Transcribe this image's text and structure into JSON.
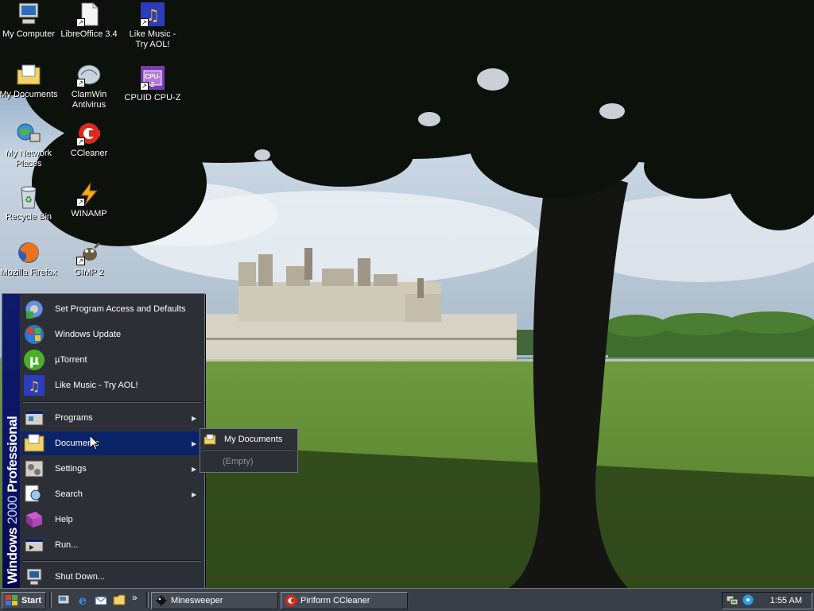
{
  "desktop": {
    "icons": [
      {
        "label": "My Computer",
        "icon": "my-computer-icon"
      },
      {
        "label": "LibreOffice 3.4",
        "icon": "libreoffice-icon"
      },
      {
        "label": "Like Music - Try AOL!",
        "icon": "like-music-icon"
      },
      {
        "label": "My Documents",
        "icon": "my-documents-icon"
      },
      {
        "label": "ClamWin Antivirus",
        "icon": "clamwin-icon"
      },
      {
        "label": "CPUID CPU-Z",
        "icon": "cpuz-icon",
        "badge": "CPU-Z"
      },
      {
        "label": "My Network Places",
        "icon": "network-places-icon"
      },
      {
        "label": "CCleaner",
        "icon": "ccleaner-icon"
      },
      {
        "label": "Recycle Bin",
        "icon": "recycle-bin-icon"
      },
      {
        "label": "WINAMP",
        "icon": "winamp-icon"
      },
      {
        "label": "Mozilla Firefox",
        "icon": "firefox-icon"
      },
      {
        "label": "GIMP 2",
        "icon": "gimp-icon"
      }
    ]
  },
  "start_menu": {
    "banner_bold": "Windows",
    "banner_thin": "2000",
    "banner_rest": "Professional",
    "pinned": [
      {
        "label": "Set Program Access and Defaults",
        "icon": "program-access-icon"
      },
      {
        "label": "Windows Update",
        "icon": "windows-update-icon"
      },
      {
        "label": "µTorrent",
        "icon": "utorrent-icon"
      },
      {
        "label": "Like Music - Try AOL!",
        "icon": "like-music-icon"
      }
    ],
    "items": [
      {
        "label": "Programs",
        "icon": "programs-icon",
        "has_submenu": true
      },
      {
        "label": "Documents",
        "icon": "documents-folder-icon",
        "has_submenu": true,
        "selected": true
      },
      {
        "label": "Settings",
        "icon": "settings-icon",
        "has_submenu": true
      },
      {
        "label": "Search",
        "icon": "search-icon",
        "has_submenu": true
      },
      {
        "label": "Help",
        "icon": "help-icon",
        "has_submenu": false
      },
      {
        "label": "Run...",
        "icon": "run-icon",
        "has_submenu": false
      }
    ],
    "shutdown": {
      "label": "Shut Down...",
      "icon": "shutdown-icon"
    }
  },
  "documents_submenu": {
    "my_documents": "My Documents",
    "empty": "(Empty)"
  },
  "taskbar": {
    "start_label": "Start",
    "quick_launch": [
      "show-desktop-icon",
      "internet-explorer-icon",
      "outlook-express-icon",
      "windows-media-icon"
    ],
    "overflow": "»",
    "tasks": [
      {
        "label": "Minesweeper",
        "icon": "minesweeper-icon"
      },
      {
        "label": "Piriform CCleaner",
        "icon": "ccleaner-icon"
      }
    ],
    "tray_icons": [
      "network-tray-icon",
      "media-tray-icon"
    ],
    "clock": "1:55 AM"
  }
}
